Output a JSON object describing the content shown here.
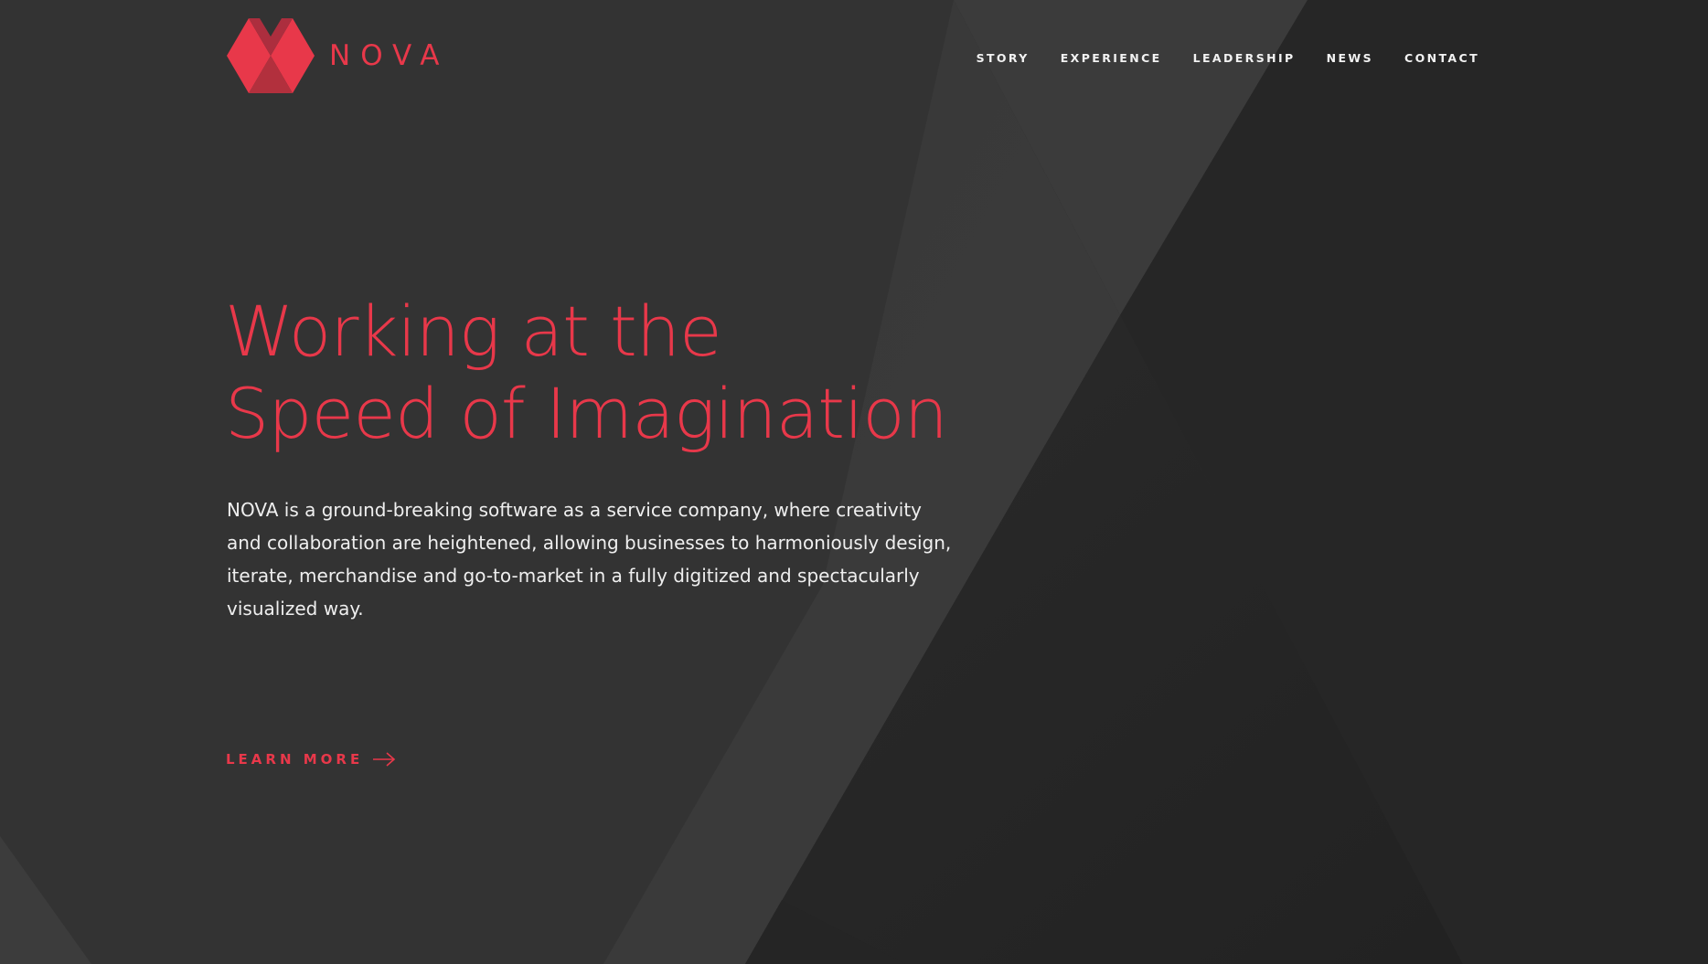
{
  "brand": {
    "name": "NOVA",
    "accent_color": "#e8384a",
    "logo_icon": "diamond-x-logo-icon"
  },
  "nav": {
    "items": [
      {
        "label": "STORY"
      },
      {
        "label": "EXPERIENCE"
      },
      {
        "label": "LEADERSHIP"
      },
      {
        "label": "NEWS"
      },
      {
        "label": "CONTACT"
      }
    ]
  },
  "hero": {
    "title_line1": "Working at the",
    "title_line2": "Speed of Imagination",
    "body": "NOVA is a ground-breaking software as a service company, where creativity and collaboration are heightened, allowing businesses to harmoniously design, iterate, merchandise and go-to-market in a fully digitized and spectacularly visualized way.",
    "cta_label": "LEARN MORE",
    "cta_icon": "arrow-right-icon"
  },
  "colors": {
    "background": "#2e2e2e",
    "text": "#efefef"
  }
}
